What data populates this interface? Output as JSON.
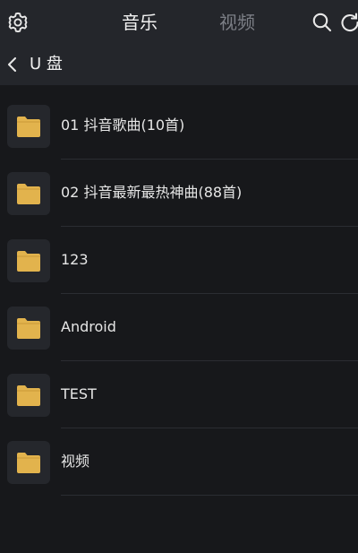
{
  "header": {
    "tabs": [
      {
        "label": "音乐",
        "active": true
      },
      {
        "label": "视频",
        "active": false
      }
    ],
    "icons": {
      "settings": "gear-icon",
      "search": "search-icon",
      "refresh": "refresh-icon"
    }
  },
  "breadcrumb": {
    "label": "U 盘",
    "icon": "chevron-left-icon"
  },
  "folders": [
    {
      "name": "01 抖音歌曲(10首)"
    },
    {
      "name": "02 抖音最新最热神曲(88首)"
    },
    {
      "name": "123"
    },
    {
      "name": "Android"
    },
    {
      "name": "TEST"
    },
    {
      "name": "视频"
    }
  ],
  "colors": {
    "background": "#17181b",
    "header": "#24262b",
    "folder": "#e2b34d",
    "inactive_tab": "#7c7f86"
  }
}
